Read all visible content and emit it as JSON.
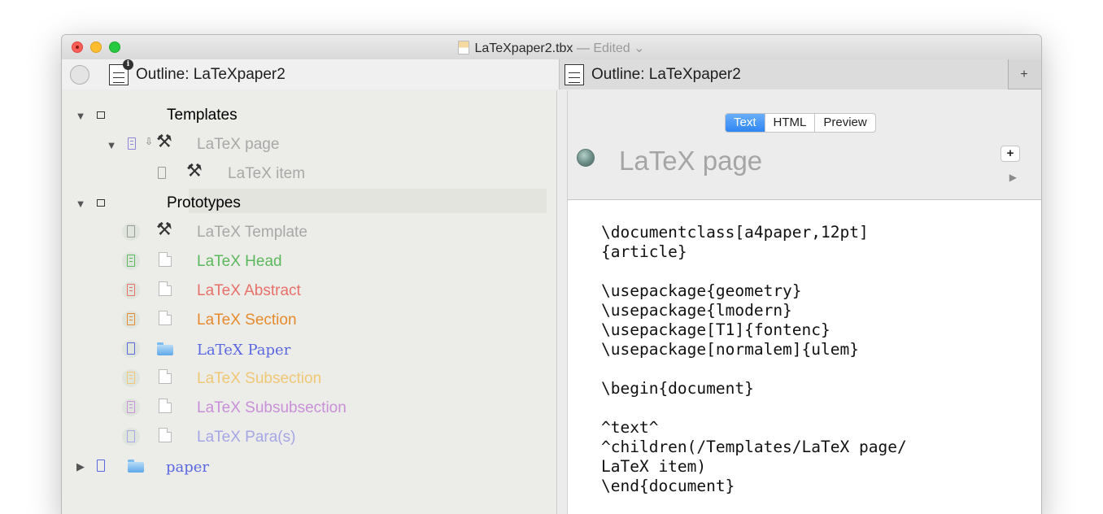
{
  "window": {
    "title": "LaTeXpaper2.tbx",
    "title_separator": "—",
    "status": "Edited",
    "status_caret": "⌄",
    "doc_icon": "tbx-document-icon"
  },
  "tabs": [
    {
      "label": "Outline: LaTeXpaper2",
      "icon": "outline-info-icon"
    },
    {
      "label": "Outline: LaTeXpaper2",
      "icon": "outline-icon"
    }
  ],
  "tab_add_label": "+",
  "outline": {
    "items": [
      {
        "label": "Templates",
        "color": "#3a3a3a"
      },
      {
        "label": "LaTeX page",
        "color": "#a8a8a8"
      },
      {
        "label": "LaTeX item",
        "color": "#a8a8a8"
      },
      {
        "label": "Prototypes",
        "color": "#3a3a3a"
      },
      {
        "label": "LaTeX Template",
        "color": "#a8a8a8"
      },
      {
        "label": "LaTeX Head",
        "color": "#5cb85c"
      },
      {
        "label": "LaTeX Abstract",
        "color": "#e8706a"
      },
      {
        "label": "LaTeX Section",
        "color": "#e78a2e"
      },
      {
        "label": "LaTeX Paper",
        "color": "#5a67e0"
      },
      {
        "label": "LaTeX Subsection",
        "color": "#f0c774"
      },
      {
        "label": "LaTeX Subsubsection",
        "color": "#c98fd8"
      },
      {
        "label": "LaTeX Para(s)",
        "color": "#a5a6e6"
      },
      {
        "label": "paper",
        "color": "#5a67e0"
      }
    ],
    "expand_open": "▼",
    "expand_closed": "▶"
  },
  "view_modes": [
    "Text",
    "HTML",
    "Preview"
  ],
  "active_view_mode": "Text",
  "note": {
    "title": "LaTeX page",
    "add_label": "+",
    "play_label": "▶",
    "badge_icon": "badge-ball-icon",
    "text": "\\documentclass[a4paper,12pt]\n{article}\n\n\\usepackage{geometry}\n\\usepackage{lmodern}\n\\usepackage[T1]{fontenc}\n\\usepackage[normalem]{ulem}\n\n\\begin{document}\n\n^text^\n^children(/Templates/LaTeX page/\nLaTeX item)\n\\end{document}"
  }
}
